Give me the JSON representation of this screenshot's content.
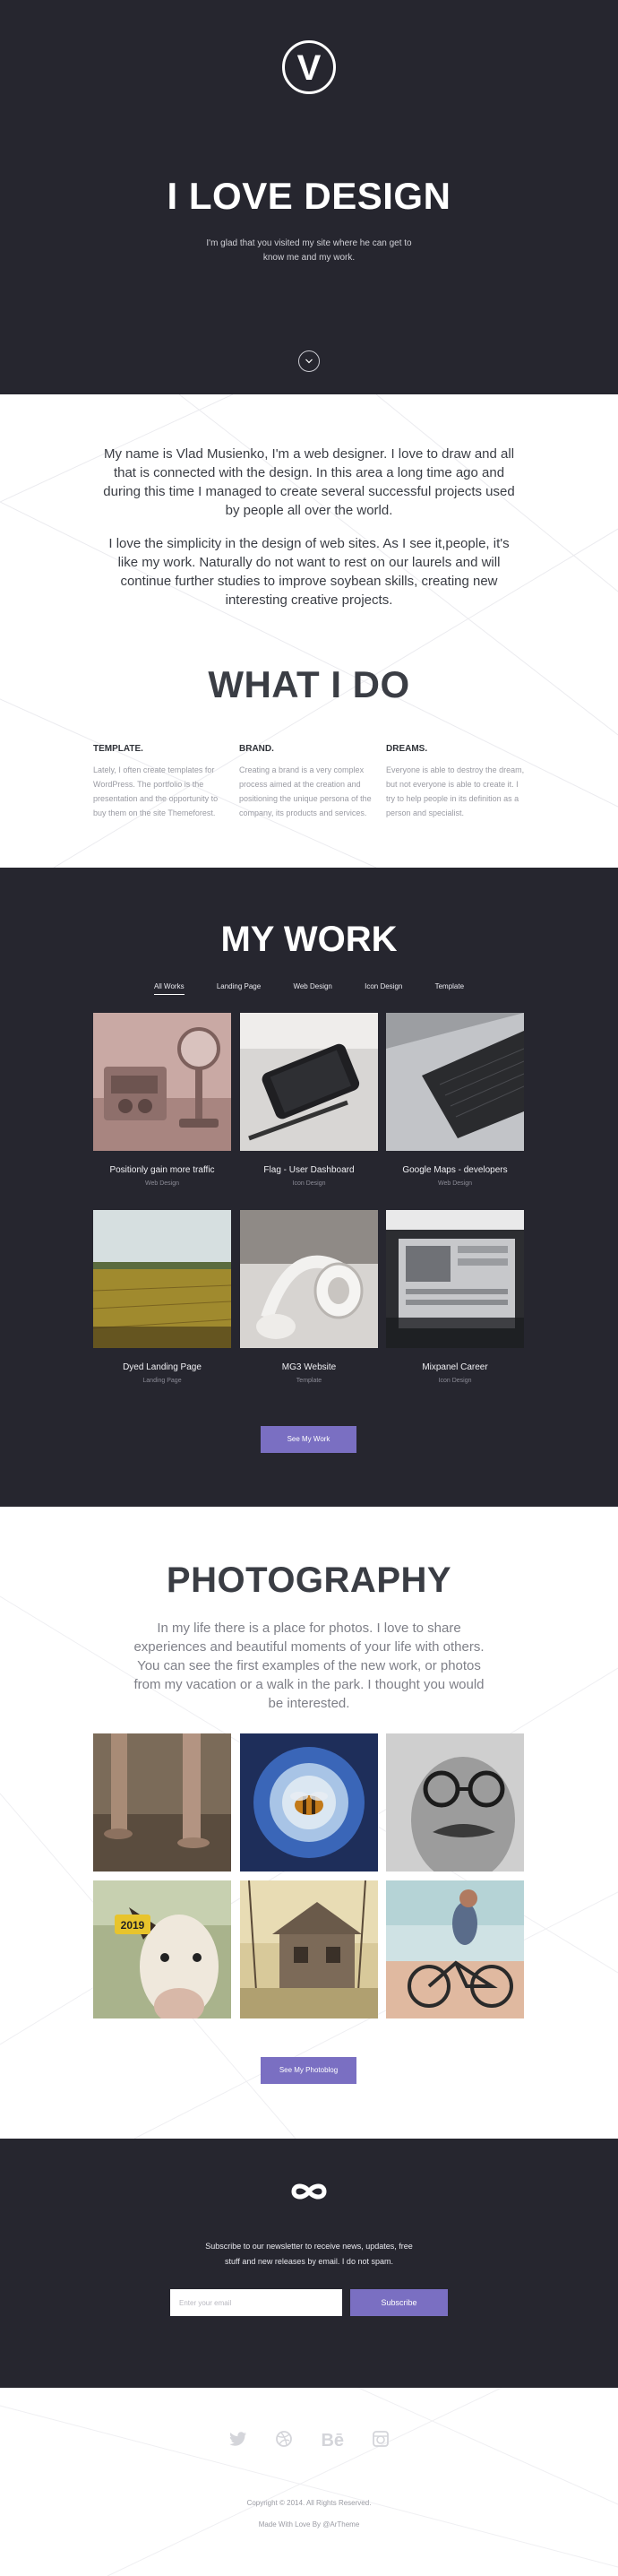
{
  "hero": {
    "logo_letter": "V",
    "title": "I LOVE DESIGN",
    "subtitle": "I'm glad that you visited my site where he can get to know me and my work."
  },
  "about": {
    "paragraphs": [
      "My name is Vlad Musienko, I'm a web designer. I love to draw and all that is connected with the design. In this area a long time ago and during this time I managed to create several successful projects used by people all over the world.",
      "I love the simplicity in the design of web sites. As I see it,people, it's like my work. Naturally do not want to rest on our laurels and will continue further studies to improve soybean skills, creating new interesting creative projects."
    ]
  },
  "what_i_do": {
    "title": "WHAT I DO",
    "columns": [
      {
        "heading": "TEMPLATE.",
        "text": "Lately, I often create templates for WordPress. The portfolio is the presentation and the opportunity to buy them on the site Themeforest."
      },
      {
        "heading": "BRAND.",
        "text": "Creating a brand is a very complex process aimed at the creation and positioning the unique persona of the company, its products and services."
      },
      {
        "heading": "DREAMS.",
        "text": "Everyone is able to destroy the dream, but not everyone is able to create it. I try to help people in its definition as a person and specialist."
      }
    ]
  },
  "my_work": {
    "title": "MY WORK",
    "filters": [
      "All Works",
      "Landing Page",
      "Web Design",
      "Icon Design",
      "Template"
    ],
    "items": [
      {
        "name": "Positionly gain more traffic",
        "category": "Web Design"
      },
      {
        "name": "Flag - User Dashboard",
        "category": "Icon Design"
      },
      {
        "name": "Google Maps - developers",
        "category": "Web Design"
      },
      {
        "name": "Dyed Landing Page",
        "category": "Landing Page"
      },
      {
        "name": "MG3 Website",
        "category": "Template"
      },
      {
        "name": "Mixpanel Career",
        "category": "Icon Design"
      }
    ],
    "button": "See My Work"
  },
  "photography": {
    "title": "PHOTOGRAPHY",
    "text": "In my life there is a place for photos. I love to share experiences and beautiful moments of your life with others. You can see the first examples of the new work, or photos from my vacation or a walk in the park. I thought you would be interested.",
    "button": "See My Photoblog",
    "cow_tag": "2019"
  },
  "newsletter": {
    "text": "Subscribe to our newsletter to receive news, updates, free stuff and new releases by email. I do not spam.",
    "email_placeholder": "Enter your email",
    "button": "Subscribe"
  },
  "footer": {
    "socials": [
      "twitter-icon",
      "dribbble-icon",
      "behance-icon",
      "instagram-icon"
    ],
    "behance_label": "Bē",
    "copyright": "Copyright © 2014. All Rights Reserved.",
    "made_by": "Made With Love By @ArThemе"
  },
  "colors": {
    "dark": "#26262f",
    "accent": "#7a6fc2",
    "text": "#3a3d44",
    "muted": "#9a9ba3"
  }
}
